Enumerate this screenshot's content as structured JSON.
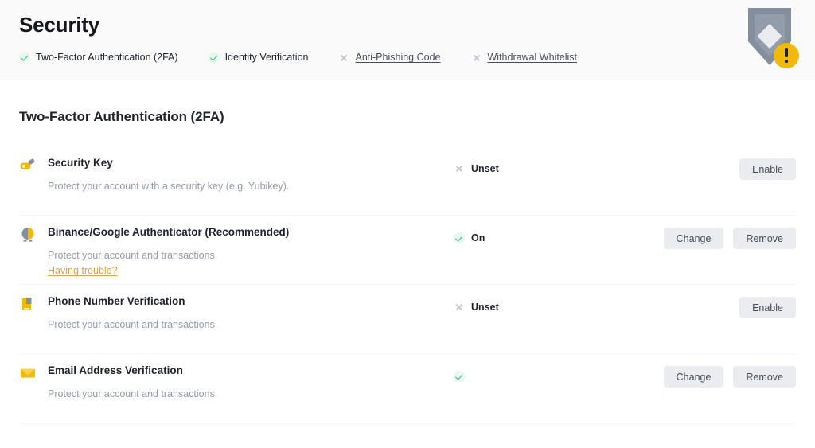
{
  "header": {
    "title": "Security",
    "shield_icon": "shield-warning-icon",
    "status_chips": [
      {
        "label": "Two-Factor Authentication (2FA)",
        "state": "on",
        "icon": "check-circle-icon"
      },
      {
        "label": "Identity Verification",
        "state": "on",
        "icon": "check-circle-icon"
      },
      {
        "label": "Anti-Phishing Code",
        "state": "unset",
        "icon": "x-icon"
      },
      {
        "label": "Withdrawal Whitelist",
        "state": "unset",
        "icon": "x-icon"
      }
    ]
  },
  "main": {
    "section_title": "Two-Factor Authentication (2FA)",
    "rows": [
      {
        "icon": "security-key-icon",
        "name": "Security Key",
        "description": "Protect your account with a security key (e.g. Yubikey).",
        "link": "",
        "status_label": "Unset",
        "status_state": "unset",
        "actions": [
          "Enable"
        ]
      },
      {
        "icon": "authenticator-icon",
        "name": "Binance/Google Authenticator (Recommended)",
        "description": "Protect your account and transactions.",
        "link": "Having trouble?",
        "status_label": "On",
        "status_state": "on",
        "actions": [
          "Change",
          "Remove"
        ]
      },
      {
        "icon": "phone-icon",
        "name": "Phone Number Verification",
        "description": "Protect your account and transactions.",
        "link": "",
        "status_label": "Unset",
        "status_state": "unset",
        "actions": [
          "Enable"
        ]
      },
      {
        "icon": "email-icon",
        "name": "Email Address Verification",
        "description": "Protect your account and transactions.",
        "link": "",
        "status_label": "",
        "status_state": "on",
        "actions": [
          "Change",
          "Remove"
        ]
      }
    ]
  },
  "colors": {
    "accent_yellow": "#f0b90b",
    "success_green": "#2ebd85",
    "text_primary": "#1e2329",
    "text_secondary": "#929aa5",
    "button_bg": "#eaecef",
    "link_yellow": "#d9a441",
    "header_bg": "#fafafa"
  }
}
